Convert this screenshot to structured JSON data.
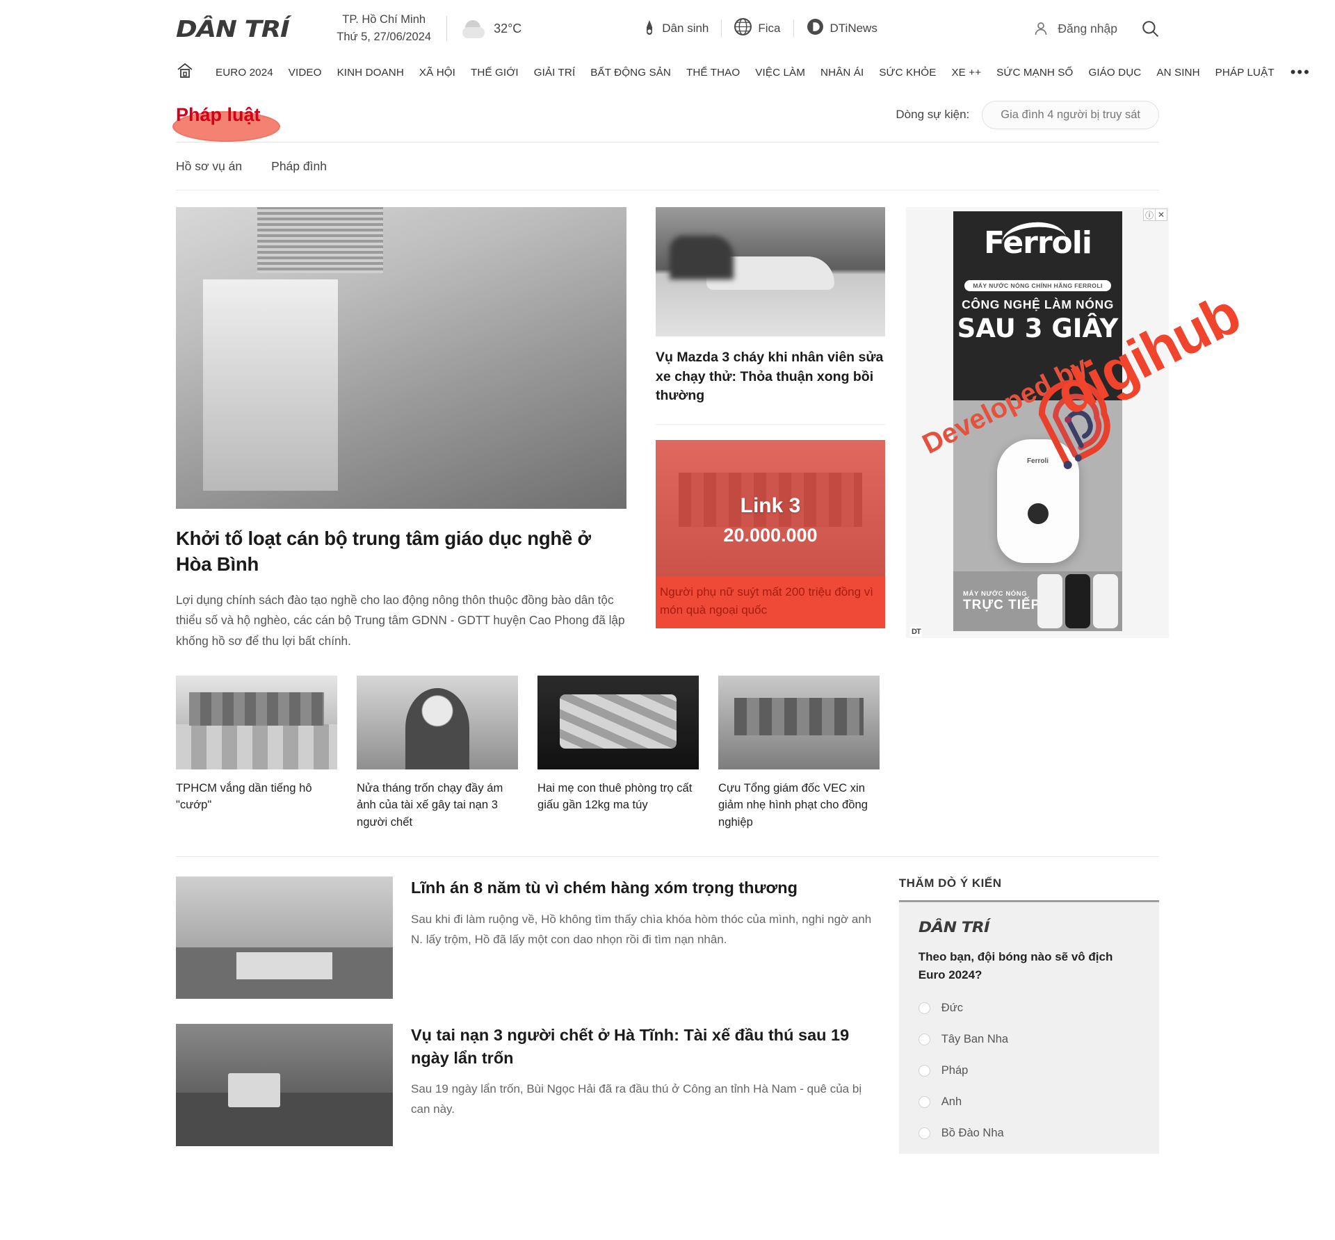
{
  "site": {
    "logo": "DÂN TRÍ",
    "location": "TP. Hồ Chí Minh",
    "date": "Thứ 5, 27/06/2024",
    "temperature": "32°C",
    "weather_icon": "cloud-icon"
  },
  "channels": [
    {
      "label": "Dân sinh",
      "icon": "pen-icon"
    },
    {
      "label": "Fica",
      "icon": "globe-icon"
    },
    {
      "label": "DTiNews",
      "icon": "d-letter-icon"
    }
  ],
  "header_actions": {
    "login_label": "Đăng nhập",
    "login_icon": "user-icon",
    "search_icon": "search-icon"
  },
  "nav": {
    "home_icon": "home-icon",
    "items": [
      "EURO 2024",
      "VIDEO",
      "KINH DOANH",
      "XÃ HỘI",
      "THẾ GIỚI",
      "GIẢI TRÍ",
      "BẤT ĐỘNG SẢN",
      "THỂ THAO",
      "VIỆC LÀM",
      "NHÂN ÁI",
      "SỨC KHỎE",
      "XE ++",
      "SỨC MẠNH SỐ",
      "GIÁO DỤC",
      "AN SINH",
      "PHÁP LUẬT"
    ],
    "more": "•••"
  },
  "section": {
    "title": "Pháp luật",
    "title_color": "#d0021b",
    "highlight_color": "#f0533c",
    "event_label": "Dòng sự kiện:",
    "event_pill": "Gia đình 4 người bị truy sát",
    "subtabs": [
      "Hồ sơ vụ án",
      "Pháp đình"
    ]
  },
  "hero": {
    "title": "Khởi tố loạt cán bộ trung tâm giáo dục nghề ở Hòa Bình",
    "sapo": "Lợi dụng chính sách đào tạo nghề cho lao động nông thôn thuộc đồng bào dân tộc thiểu số và hộ nghèo, các cán bộ Trung tâm GDNN - GDTT huyện Cao Phong đã lập khống hồ sơ để thu lợi bất chính."
  },
  "mid": {
    "article_title": "Vụ Mazda 3 cháy khi nhân viên sửa xe chạy thử: Thỏa thuận xong bồi thường",
    "promo": {
      "label": "Link 3",
      "amount": "20.000.000",
      "caption": "Người phụ nữ suýt mất 200 triệu đồng vì món quà ngoại quốc",
      "tint_color": "#ea4335"
    }
  },
  "ad": {
    "info_icon": "info-icon",
    "close_icon": "close-icon",
    "brand": "Ferroli",
    "pill": "MÁY NƯỚC NÓNG CHÍNH HÃNG FERROLI",
    "line2": "CÔNG NGHỆ LÀM NÓNG",
    "line3": "SAU 3 GIÂY",
    "bottom_line1": "MÁY NƯỚC NÓNG",
    "bottom_line2": "TRỰC TIẾP",
    "dt_tag": "DT"
  },
  "cards": [
    {
      "title": "TPHCM vắng dần tiếng hô \"cướp\""
    },
    {
      "title": "Nửa tháng trốn chạy đầy ám ảnh của tài xế gây tai nạn 3 người chết"
    },
    {
      "title": "Hai mẹ con thuê phòng trọ cất giấu gần 12kg ma túy"
    },
    {
      "title": "Cựu Tổng giám đốc VEC xin giảm nhẹ hình phạt cho đồng nghiệp"
    }
  ],
  "bottom_articles": [
    {
      "title": "Lĩnh án 8 năm tù vì chém hàng xóm trọng thương",
      "sapo": "Sau khi đi làm ruộng về, Hồ không tìm thấy chìa khóa hòm thóc của mình, nghi ngờ anh N. lấy trộm, Hồ đã lấy một con dao nhọn rồi đi tìm nạn nhân."
    },
    {
      "title": "Vụ tai nạn 3 người chết ở Hà Tĩnh: Tài xế đầu thú sau 19 ngày lẩn trốn",
      "sapo": "Sau 19 ngày lẩn trốn, Bùi Ngọc Hải đã ra đầu thú ở Công an tỉnh Hà Nam - quê của bị can này."
    }
  ],
  "poll": {
    "heading": "THĂM DÒ Ý KIẾN",
    "logo": "DÂN TRÍ",
    "question": "Theo bạn, đội bóng nào sẽ vô địch Euro 2024?",
    "options": [
      "Đức",
      "Tây Ban Nha",
      "Pháp",
      "Anh",
      "Bồ Đào Nha"
    ]
  },
  "watermark": {
    "prefix": "Developed by",
    "brand": "digihub",
    "color": "#f0442c"
  }
}
